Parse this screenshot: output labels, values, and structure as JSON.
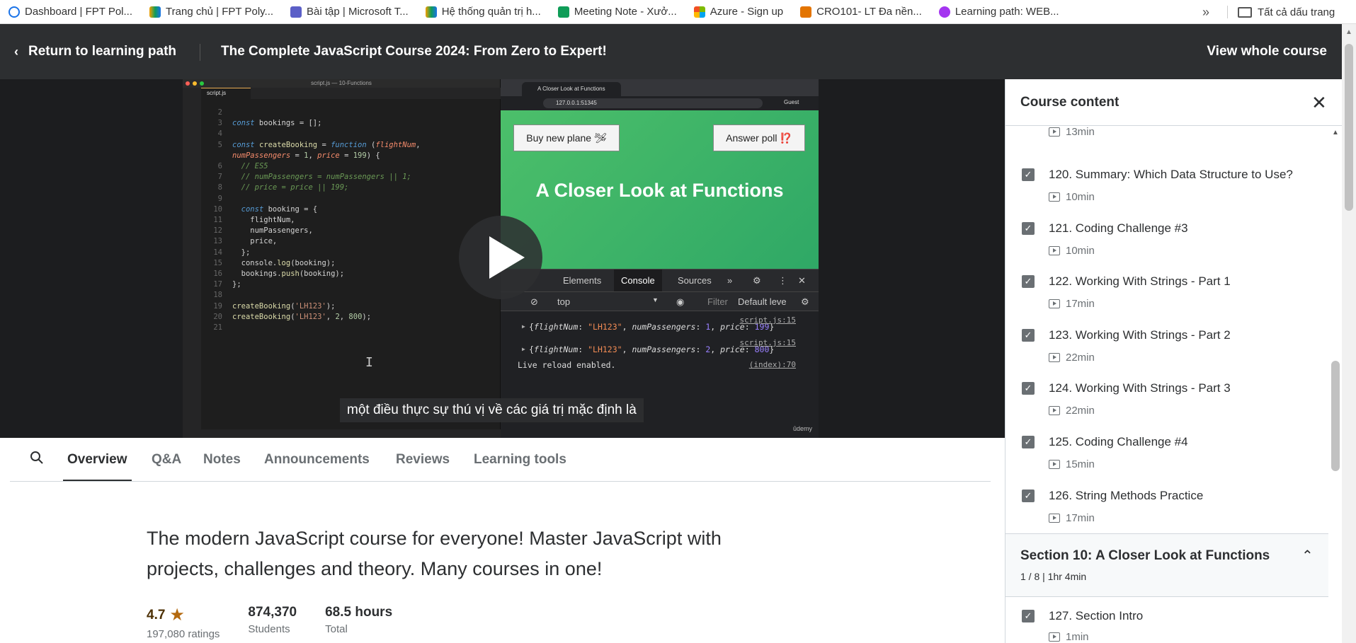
{
  "bookmarks": [
    {
      "label": "Dashboard | FPT Pol...",
      "color": "#1a73e8"
    },
    {
      "label": "Trang chủ | FPT Poly...",
      "color": "#f59f00"
    },
    {
      "label": "Bài tập | Microsoft T...",
      "color": "#5b5fc7"
    },
    {
      "label": "Hệ thống quản trị h...",
      "color": "#f59f00"
    },
    {
      "label": "Meeting Note - Xưở...",
      "color": "#0f9d58"
    },
    {
      "label": "Azure - Sign up",
      "color": "#f25022"
    },
    {
      "label": "CRO101- LT Đa nền...",
      "color": "#e37400"
    },
    {
      "label": "Learning path: WEB...",
      "color": "#a435f0"
    }
  ],
  "bookmarks_more": "»",
  "bookmarks_all": "Tất cả dấu trang",
  "header": {
    "back_label": "Return to learning path",
    "course_title": "The Complete JavaScript Course 2024: From Zero to Expert!",
    "view_whole": "View whole course"
  },
  "video": {
    "editor_title": "script.js — 10-Functions",
    "editor_tab": "script.js",
    "browser_tab": "A Closer Look at Functions",
    "browser_url": "127.0.0.1:51345",
    "browser_profile": "Guest",
    "buy_button": "Buy new plane 🛩",
    "poll_button": "Answer poll ⁉️",
    "page_heading": "A Closer Look at Functions",
    "devtools_tabs": [
      "Elements",
      "Console",
      "Sources"
    ],
    "filter_context": "top",
    "filter_label": "Filter",
    "levels_label": "Default leve",
    "console": [
      {
        "src": "script.js:15",
        "text": "{flightNum: \"LH123\", numPassengers: 1, price: 199}"
      },
      {
        "src": "script.js:15",
        "text": "{flightNum: \"LH123\", numPassengers: 2, price: 800}"
      },
      {
        "src": "(index):70",
        "text": "Live reload enabled."
      }
    ],
    "caption": "một điều thực sự thú vị về các giá trị mặc định là",
    "watermark": "ûdemy"
  },
  "tabs": [
    "Overview",
    "Q&A",
    "Notes",
    "Announcements",
    "Reviews",
    "Learning tools"
  ],
  "overview": {
    "description": "The modern JavaScript course for everyone! Master JavaScript with projects, challenges and theory. Many courses in one!",
    "rating": "4.7",
    "rating_count": "197,080 ratings",
    "students": "874,370",
    "students_label": "Students",
    "hours": "68.5 hours",
    "hours_label": "Total"
  },
  "sidebar": {
    "title": "Course content",
    "top_partial": {
      "duration": "13min"
    },
    "lectures": [
      {
        "title": "120. Summary: Which Data Structure to Use?",
        "duration": "10min"
      },
      {
        "title": "121. Coding Challenge #3",
        "duration": "10min"
      },
      {
        "title": "122. Working With Strings - Part 1",
        "duration": "17min"
      },
      {
        "title": "123. Working With Strings - Part 2",
        "duration": "22min"
      },
      {
        "title": "124. Working With Strings - Part 3",
        "duration": "22min"
      },
      {
        "title": "125. Coding Challenge #4",
        "duration": "15min"
      },
      {
        "title": "126. String Methods Practice",
        "duration": "17min"
      }
    ],
    "section": {
      "title": "Section 10: A Closer Look at Functions",
      "meta": "1 / 8 | 1hr 4min"
    },
    "after_section": {
      "title": "127. Section Intro",
      "duration": "1min"
    }
  }
}
